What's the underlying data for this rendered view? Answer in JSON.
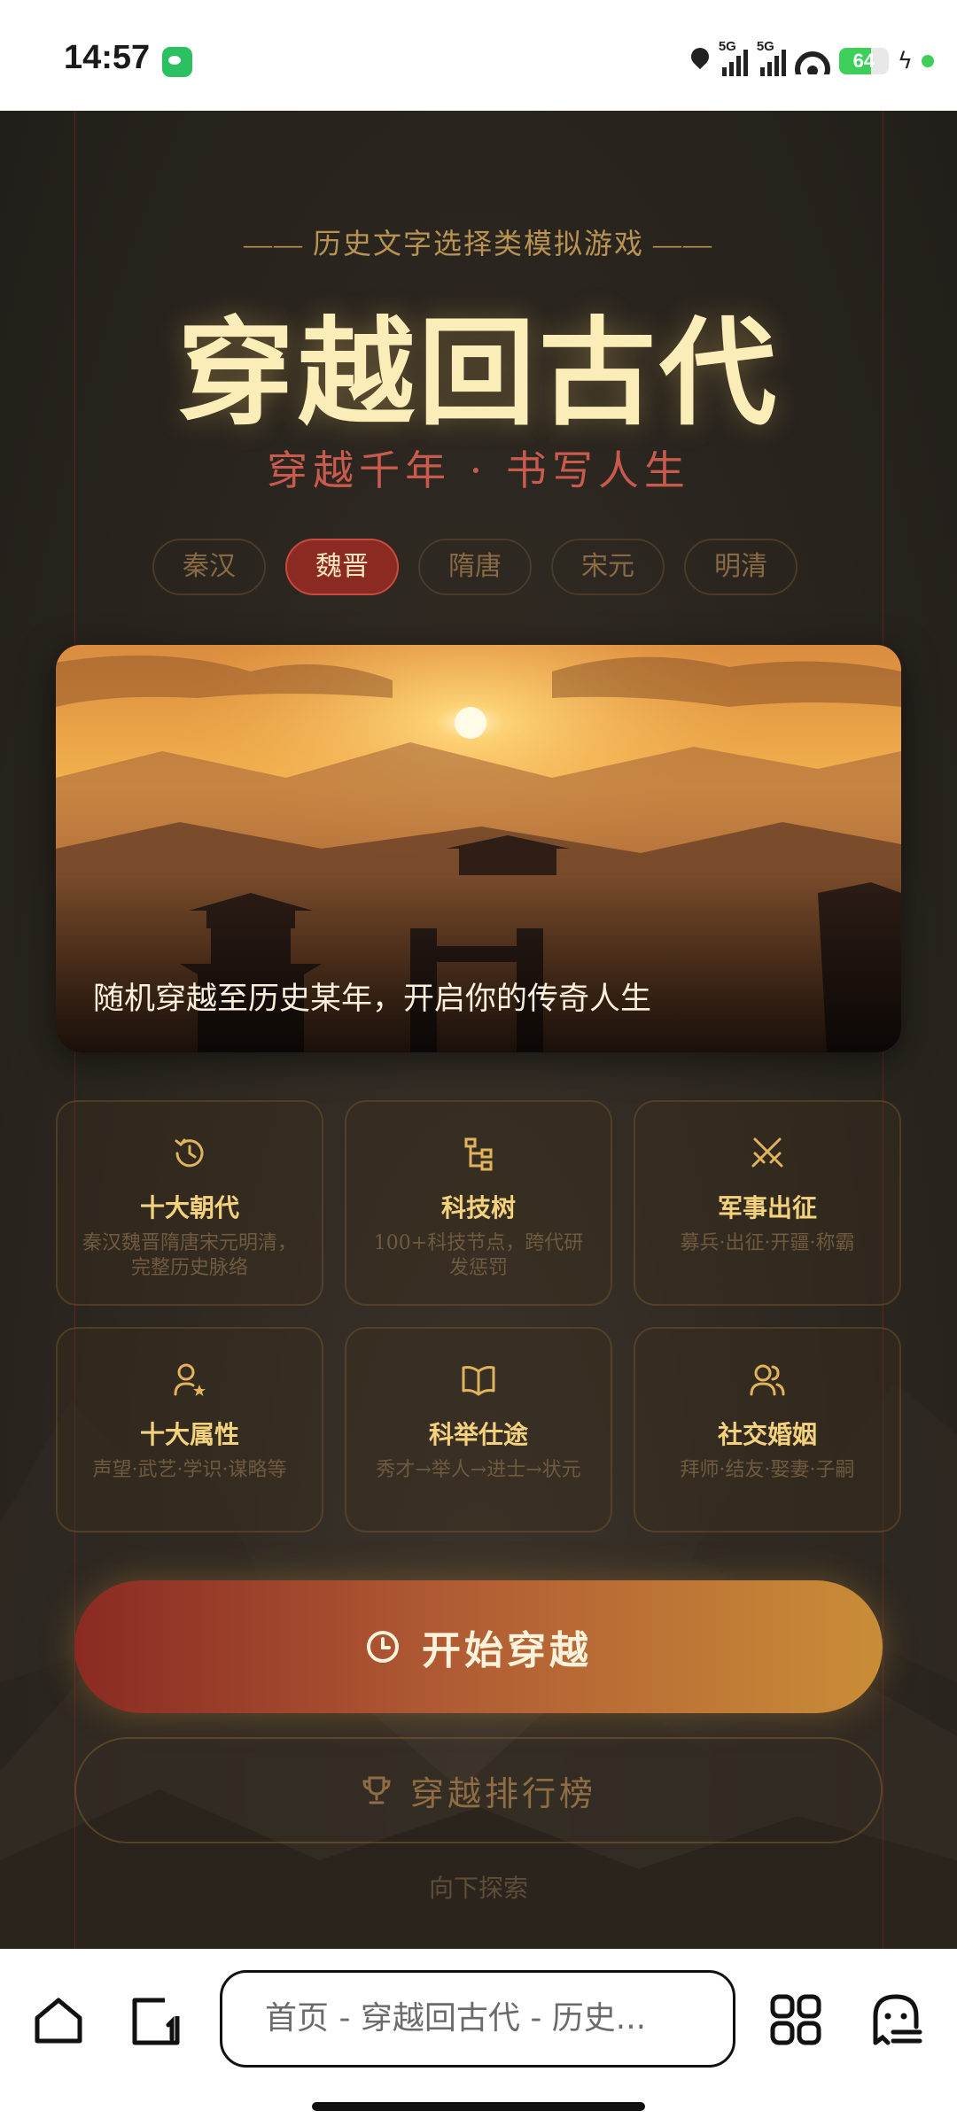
{
  "status_bar": {
    "time": "14:57",
    "network_1": "5G",
    "network_2": "5G",
    "battery": "64",
    "icons": [
      "wechat-icon",
      "location-icon",
      "signal-icon",
      "wifi-icon",
      "battery-icon",
      "charging-icon"
    ]
  },
  "header": {
    "subtitle": "—— 历史文字选择类模拟游戏 ——",
    "title": "穿越回古代",
    "tagline": "穿越千年 · 书写人生"
  },
  "eras": [
    {
      "label": "秦汉",
      "active": false
    },
    {
      "label": "魏晋",
      "active": true
    },
    {
      "label": "隋唐",
      "active": false
    },
    {
      "label": "宋元",
      "active": false
    },
    {
      "label": "明清",
      "active": false
    }
  ],
  "hero": {
    "caption": "随机穿越至历史某年，开启你的传奇人生"
  },
  "features": [
    {
      "icon": "history-icon",
      "title": "十大朝代",
      "desc": "秦汉魏晋隋唐宋元明清，完整历史脉络"
    },
    {
      "icon": "tech-tree-icon",
      "title": "科技树",
      "desc": "100+科技节点，跨代研发惩罚"
    },
    {
      "icon": "swords-icon",
      "title": "军事出征",
      "desc": "募兵·出征·开疆·称霸"
    },
    {
      "icon": "user-star-icon",
      "title": "十大属性",
      "desc": "声望·武艺·学识·谋略等"
    },
    {
      "icon": "book-icon",
      "title": "科举仕途",
      "desc": "秀才→举人→进士→状元"
    },
    {
      "icon": "users-icon",
      "title": "社交婚姻",
      "desc": "拜师·结友·娶妻·子嗣"
    }
  ],
  "buttons": {
    "start": "开始穿越",
    "ranking": "穿越排行榜"
  },
  "explore": "向下探索",
  "browser": {
    "url": "首页 - 穿越回古代 - 历史..."
  },
  "colors": {
    "accent_red": "#8b2a22",
    "accent_gold": "#f3d17d",
    "title_cream": "#fbedb8"
  }
}
